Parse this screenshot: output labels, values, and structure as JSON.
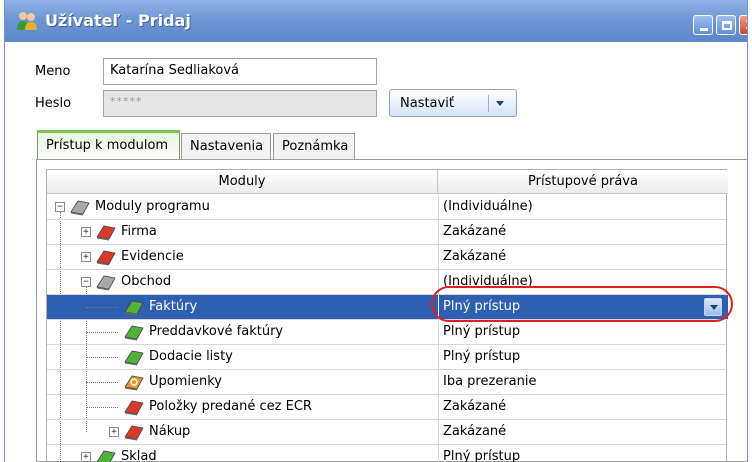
{
  "window": {
    "title": "Užívateľ - Pridaj"
  },
  "form": {
    "name_label": "Meno",
    "name_value": "Katarína Sedliaková",
    "password_label": "Heslo",
    "password_value": "*****",
    "set_button_label": "Nastaviť"
  },
  "tabs": [
    {
      "label": "Prístup k modulom",
      "active": true
    },
    {
      "label": "Nastavenia",
      "active": false
    },
    {
      "label": "Poznámka",
      "active": false
    }
  ],
  "grid": {
    "columns": [
      "Moduly",
      "Prístupové práva"
    ],
    "rows": [
      {
        "name": "Moduly programu",
        "rights": "(Individuálne)",
        "level": 0,
        "expander": "−",
        "icon": "gray"
      },
      {
        "name": "Firma",
        "rights": "Zakázané",
        "level": 1,
        "expander": "+",
        "icon": "red"
      },
      {
        "name": "Evidencie",
        "rights": "Zakázané",
        "level": 1,
        "expander": "+",
        "icon": "red"
      },
      {
        "name": "Obchod",
        "rights": "(Individuálne)",
        "level": 1,
        "expander": "−",
        "icon": "gray"
      },
      {
        "name": "Faktúry",
        "rights": "Plný prístup",
        "level": 2,
        "expander": "",
        "icon": "green",
        "selected": true
      },
      {
        "name": "Preddavkové faktúry",
        "rights": "Plný prístup",
        "level": 2,
        "expander": "",
        "icon": "green"
      },
      {
        "name": "Dodacie listy",
        "rights": "Plný prístup",
        "level": 2,
        "expander": "",
        "icon": "green"
      },
      {
        "name": "Upomienky",
        "rights": "Iba prezeranie",
        "level": 2,
        "expander": "",
        "icon": "orange"
      },
      {
        "name": "Položky predané cez ECR",
        "rights": "Zakázané",
        "level": 2,
        "expander": "",
        "icon": "red"
      },
      {
        "name": "Nákup",
        "rights": "Zakázané",
        "level": 2,
        "expander": "+",
        "icon": "red"
      },
      {
        "name": "Sklad",
        "rights": "Plný prístup",
        "level": 1,
        "expander": "+",
        "icon": "green"
      }
    ]
  },
  "colors": {
    "selection": "#2f5fb0",
    "icon_red": "#d83a2a",
    "icon_green": "#4fb33a",
    "icon_gray": "#a8a8a8",
    "icon_orange": "#e8962a",
    "highlight_oval": "#e02020"
  },
  "icons": {
    "title": "users-icon",
    "minimize": "minimize-icon",
    "maximize": "maximize-icon",
    "close": "close-icon",
    "dropdown": "chevron-down-icon"
  }
}
